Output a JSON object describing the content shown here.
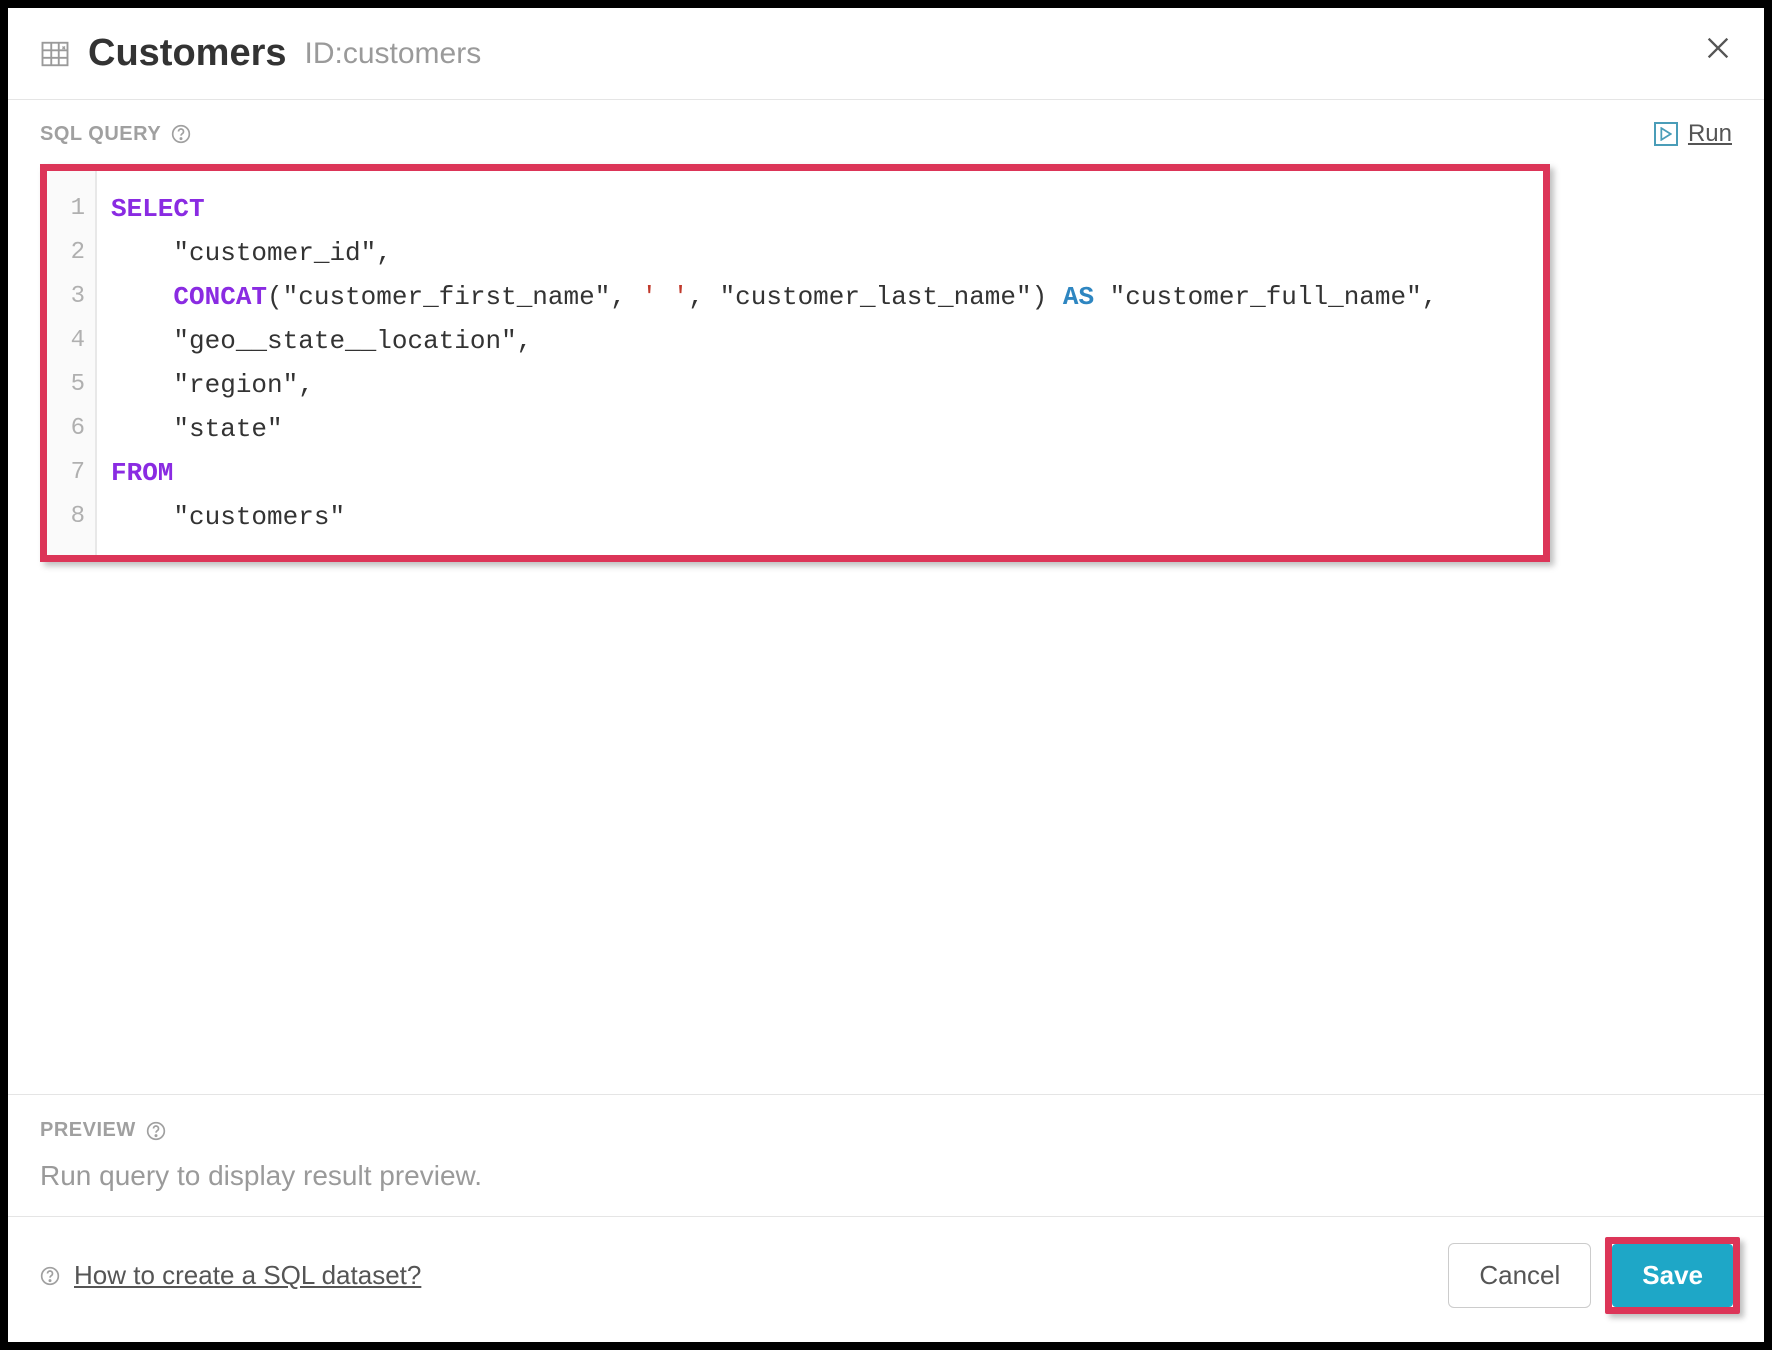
{
  "header": {
    "title": "Customers",
    "subtitle": "ID:customers"
  },
  "query_section": {
    "label": "SQL QUERY",
    "run_label": "Run"
  },
  "code": {
    "line_numbers": [
      "1",
      "2",
      "3",
      "4",
      "5",
      "6",
      "7",
      "8"
    ],
    "lines": {
      "l1_kw": "SELECT",
      "l2_indent": "    ",
      "l2_text": "\"customer_id\",",
      "l3_indent": "    ",
      "l3_concat": "CONCAT",
      "l3_open": "(",
      "l3_arg1": "\"customer_first_name\"",
      "l3_comma1": ", ",
      "l3_lit": "' '",
      "l3_comma2": ", ",
      "l3_arg2": "\"customer_last_name\"",
      "l3_close": ") ",
      "l3_as": "AS",
      "l3_alias": " \"customer_full_name\",",
      "l4_indent": "    ",
      "l4_text": "\"geo__state__location\",",
      "l5_indent": "    ",
      "l5_text": "\"region\",",
      "l6_indent": "    ",
      "l6_text": "\"state\"",
      "l7_kw": "FROM",
      "l8_indent": "    ",
      "l8_text": "\"customers\""
    }
  },
  "preview": {
    "label": "PREVIEW",
    "message": "Run query to display result preview."
  },
  "footer": {
    "help_link": "How to create a SQL dataset?",
    "cancel_label": "Cancel",
    "save_label": "Save"
  }
}
